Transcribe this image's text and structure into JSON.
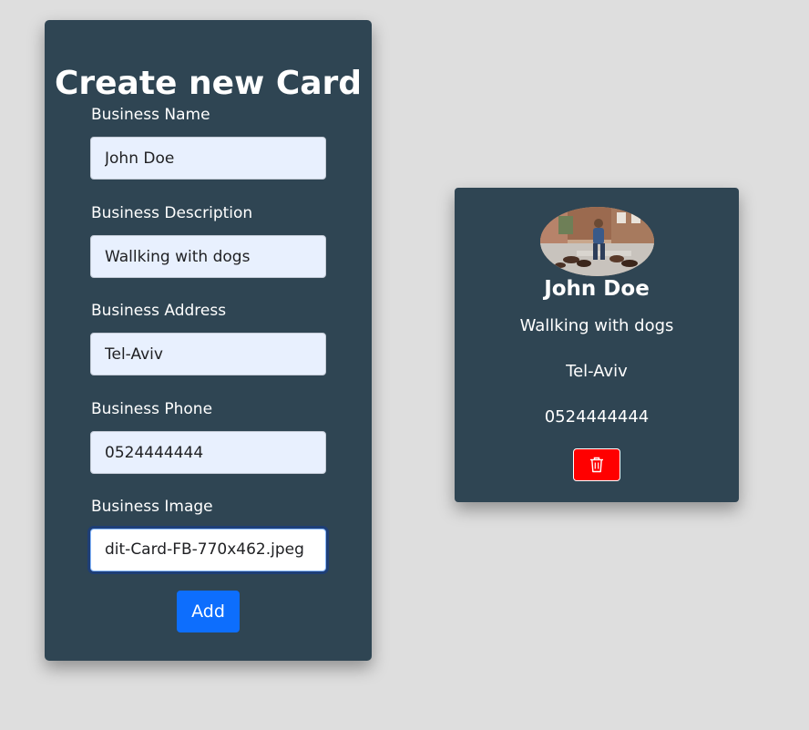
{
  "form": {
    "title": "Create new Card",
    "fields": [
      {
        "label": "Business Name",
        "value": "John Doe"
      },
      {
        "label": "Business Description",
        "value": "Wallking with dogs"
      },
      {
        "label": "Business Address",
        "value": "Tel-Aviv"
      },
      {
        "label": "Business Phone",
        "value": "0524444444"
      },
      {
        "label": "Business Image",
        "value": "dit-Card-FB-770x462.jpeg"
      }
    ],
    "add_label": "Add"
  },
  "card": {
    "image_icon": "dog-walker-photo",
    "name": "John Doe",
    "description": "Wallking with dogs",
    "address": "Tel-Aviv",
    "phone": "0524444444",
    "delete_icon": "trash-icon"
  },
  "colors": {
    "page_background": "#dedede",
    "card_background": "#2f4553",
    "input_background": "#e8f0fe",
    "add_button": "#0d6efd",
    "delete_button": "#ff0000"
  }
}
